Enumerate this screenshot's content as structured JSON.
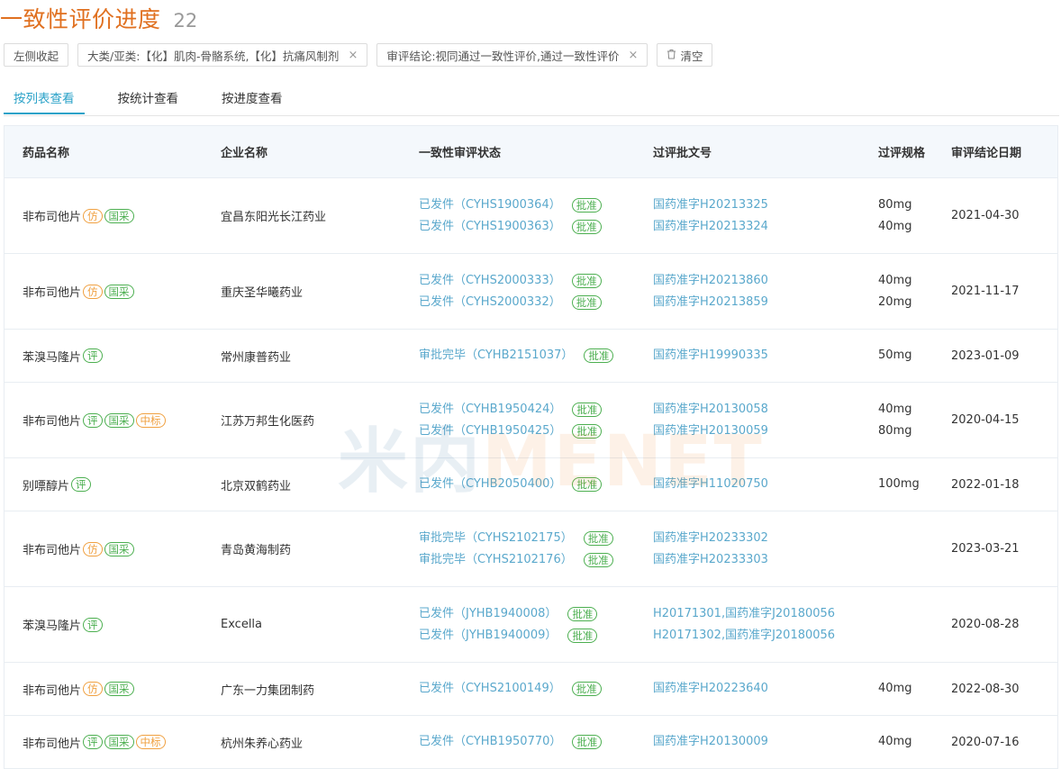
{
  "header": {
    "title": "一致性评价进度",
    "count": "22"
  },
  "filters": {
    "collapse_label": "左侧收起",
    "category_label": "大类/亚类:【化】肌肉-骨骼系统,【化】抗痛风制剂",
    "conclusion_label": "审评结论:视同通过一致性评价,通过一致性评价",
    "clear_label": "清空",
    "close_glyph": "×",
    "trash_icon": "trash-icon"
  },
  "tabs": [
    {
      "label": "按列表查看",
      "active": true
    },
    {
      "label": "按统计查看",
      "active": false
    },
    {
      "label": "按进度查看",
      "active": false
    }
  ],
  "table": {
    "headers": [
      "药品名称",
      "企业名称",
      "一致性审评状态",
      "过评批文号",
      "过评规格",
      "审评结论日期"
    ],
    "rows": [
      {
        "drug": "非布司他片",
        "tags": [
          "仿",
          "国采"
        ],
        "company": "宜昌东阳光长江药业",
        "status": [
          "已发件（CYHS1900364）",
          "已发件（CYHS1900363）"
        ],
        "approval_tag": "批准",
        "approvals": [
          "国药准字H20213325",
          "国药准字H20213324"
        ],
        "specs": [
          "80mg",
          "40mg"
        ],
        "date": "2021-04-30"
      },
      {
        "drug": "非布司他片",
        "tags": [
          "仿",
          "国采"
        ],
        "company": "重庆圣华曦药业",
        "status": [
          "已发件（CYHS2000333）",
          "已发件（CYHS2000332）"
        ],
        "approval_tag": "批准",
        "approvals": [
          "国药准字H20213860",
          "国药准字H20213859"
        ],
        "specs": [
          "40mg",
          "20mg"
        ],
        "date": "2021-11-17"
      },
      {
        "drug": "苯溴马隆片",
        "tags": [
          "评"
        ],
        "company": "常州康普药业",
        "status": [
          "审批完毕（CYHB2151037）"
        ],
        "approval_tag": "批准",
        "approvals": [
          "国药准字H19990335"
        ],
        "specs": [
          "50mg"
        ],
        "date": "2023-01-09"
      },
      {
        "drug": "非布司他片",
        "tags": [
          "评",
          "国采",
          "中标"
        ],
        "company": "江苏万邦生化医药",
        "status": [
          "已发件（CYHB1950424）",
          "已发件（CYHB1950425）"
        ],
        "approval_tag": "批准",
        "approvals": [
          "国药准字H20130058",
          "国药准字H20130059"
        ],
        "specs": [
          "40mg",
          "80mg"
        ],
        "date": "2020-04-15"
      },
      {
        "drug": "别嘌醇片",
        "tags": [
          "评"
        ],
        "company": "北京双鹤药业",
        "status": [
          "已发件（CYHB2050400）"
        ],
        "approval_tag": "批准",
        "approvals": [
          "国药准字H11020750"
        ],
        "specs": [
          "100mg"
        ],
        "date": "2022-01-18"
      },
      {
        "drug": "非布司他片",
        "tags": [
          "仿",
          "国采"
        ],
        "company": "青岛黄海制药",
        "status": [
          "审批完毕（CYHS2102175）",
          "审批完毕（CYHS2102176）"
        ],
        "approval_tag": "批准",
        "approvals": [
          "国药准字H20233302",
          "国药准字H20233303"
        ],
        "specs": [],
        "date": "2023-03-21"
      },
      {
        "drug": "苯溴马隆片",
        "tags": [
          "评"
        ],
        "company": "Excella",
        "status": [
          "已发件（JYHB1940008）",
          "已发件（JYHB1940009）"
        ],
        "approval_tag": "批准",
        "approvals": [
          "H20171301,国药准字J20180056",
          "H20171302,国药准字J20180056"
        ],
        "specs": [],
        "date": "2020-08-28"
      },
      {
        "drug": "非布司他片",
        "tags": [
          "仿",
          "国采"
        ],
        "company": "广东一力集团制药",
        "status": [
          "已发件（CYHS2100149）"
        ],
        "approval_tag": "批准",
        "approvals": [
          "国药准字H20223640"
        ],
        "specs": [
          "40mg"
        ],
        "date": "2022-08-30"
      },
      {
        "drug": "非布司他片",
        "tags": [
          "评",
          "国采",
          "中标"
        ],
        "company": "杭州朱养心药业",
        "status": [
          "已发件（CYHB1950770）"
        ],
        "approval_tag": "批准",
        "approvals": [
          "国药准字H20130009"
        ],
        "specs": [
          "40mg"
        ],
        "date": "2020-07-16"
      }
    ]
  },
  "watermark": {
    "part1": "米内",
    "part2": "MENET"
  },
  "colors": {
    "title": "#e07020",
    "link": "#5aa8cc",
    "tab_active": "#2aa2c8",
    "tag_green": "#4caf50",
    "tag_orange": "#f0a040"
  }
}
